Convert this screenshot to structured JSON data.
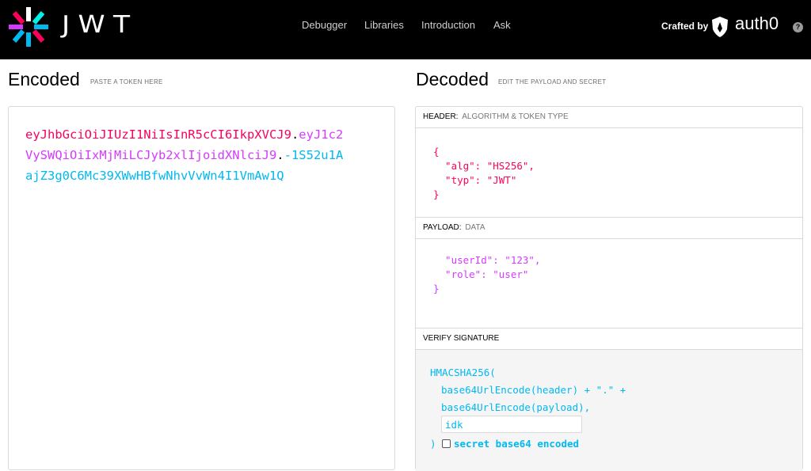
{
  "nav": {
    "logo_text": "JWT",
    "items": [
      "Debugger",
      "Libraries",
      "Introduction",
      "Ask"
    ],
    "crafted_by": "Crafted by",
    "brand": "auth0",
    "help": "?"
  },
  "encoded": {
    "title": "Encoded",
    "subtitle": "PASTE A TOKEN HERE",
    "token_header": "eyJhbGciOiJIUzI1NiIsInR5cCI6IkpXVCJ9",
    "token_payload": "eyJ1c2VySWQiOiIxMjMiLCJyb2xlIjoidXNlciJ9",
    "token_signature": "-1S52u1AajZ3g0C6Mc39XWwHBfwNhvVvWn4I1VmAw1Q",
    "dot": "."
  },
  "decoded": {
    "title": "Decoded",
    "subtitle": "EDIT THE PAYLOAD AND SECRET",
    "header": {
      "label": "HEADER:",
      "sub": "ALGORITHM & TOKEN TYPE",
      "lines": [
        "{",
        "  \"alg\": \"HS256\",",
        "  \"typ\": \"JWT\"",
        "}"
      ]
    },
    "payload": {
      "label": "PAYLOAD:",
      "sub": "DATA",
      "lines": [
        "  \"userId\": \"123\",",
        "  \"role\": \"user\"",
        "}"
      ]
    },
    "verify": {
      "label": "VERIFY SIGNATURE",
      "fn": "HMACSHA256(",
      "arg1": "base64UrlEncode(header) + \".\" +",
      "arg2": "base64UrlEncode(payload),",
      "secret_value": "idk",
      "close": ")",
      "checkbox_label": "secret base64 encoded"
    }
  },
  "colors": {
    "header": "#fb015b",
    "payload": "#d63aff",
    "signature": "#00b9f1"
  }
}
